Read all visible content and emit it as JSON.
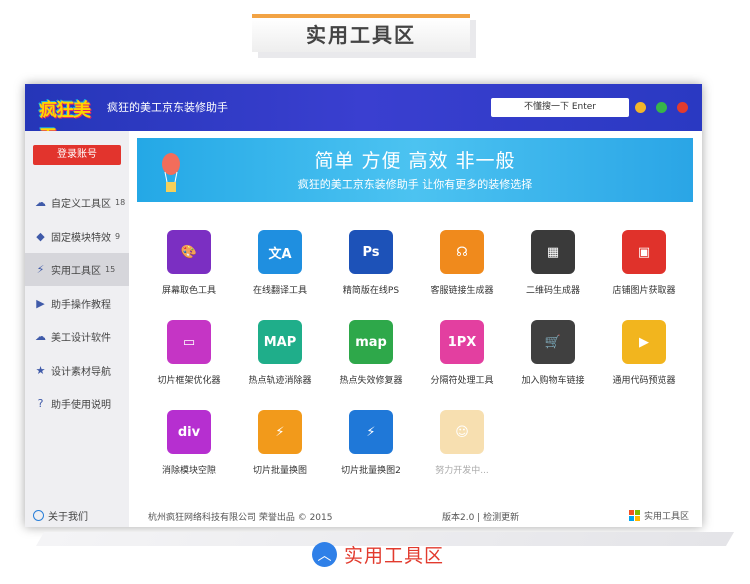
{
  "header_tab": "实用工具区",
  "window": {
    "logo_text": "疯狂美工",
    "app_title": "疯狂的美工京东装修助手",
    "search_placeholder": "不懂搜一下 Enter",
    "controls": [
      "#f3b52a",
      "#37b54a",
      "#e23b2e"
    ]
  },
  "sidebar": {
    "login": "登录账号",
    "items": [
      {
        "icon": "cloud-icon",
        "label": "自定义工具区",
        "count": "18"
      },
      {
        "icon": "cube-icon",
        "label": "固定模块特效",
        "count": "9"
      },
      {
        "icon": "bolt-icon",
        "label": "实用工具区",
        "count": "15",
        "active": true
      },
      {
        "icon": "play-icon",
        "label": "助手操作教程",
        "count": ""
      },
      {
        "icon": "cloud-download-icon",
        "label": "美工设计软件",
        "count": ""
      },
      {
        "icon": "star-icon",
        "label": "设计素材导航",
        "count": ""
      },
      {
        "icon": "help-icon",
        "label": "助手使用说明",
        "count": ""
      }
    ],
    "about": "关于我们"
  },
  "banner": {
    "title": "简单 方便 高效 非一般",
    "subtitle": "疯狂的美工京东装修助手 让你有更多的装修选择"
  },
  "tools": [
    {
      "name": "palette-icon",
      "label": "屏幕取色工具",
      "glyph": "🎨",
      "color": "#7b2fc2"
    },
    {
      "name": "translate-icon",
      "label": "在线翻译工具",
      "glyph": "文A",
      "color": "#1f8fe0"
    },
    {
      "name": "photoshop-icon",
      "label": "精简版在线PS",
      "glyph": "Ps",
      "color": "#1d52b8"
    },
    {
      "name": "headset-icon",
      "label": "客服链接生成器",
      "glyph": "☊",
      "color": "#f08a1c"
    },
    {
      "name": "qrcode-icon",
      "label": "二维码生成器",
      "glyph": "▦",
      "color": "#3a3a3a"
    },
    {
      "name": "image-download-icon",
      "label": "店铺图片获取器",
      "glyph": "▣",
      "color": "#e0322b"
    },
    {
      "name": "slice-icon",
      "label": "切片框架优化器",
      "glyph": "▭",
      "color": "#c535c5"
    },
    {
      "name": "map-icon",
      "label": "热点轨迹消除器",
      "glyph": "MAP",
      "color": "#1fae8a"
    },
    {
      "name": "map-repair-icon",
      "label": "热点失效修复器",
      "glyph": "map",
      "color": "#2ea84a"
    },
    {
      "name": "pixel-icon",
      "label": "分隔符处理工具",
      "glyph": "1PX",
      "color": "#e33fa0"
    },
    {
      "name": "cart-icon",
      "label": "加入购物车链接",
      "glyph": "🛒",
      "color": "#404040"
    },
    {
      "name": "code-viewer-icon",
      "label": "通用代码预览器",
      "glyph": "▶",
      "color": "#f2b51e"
    },
    {
      "name": "div-icon",
      "label": "消除模块空隙",
      "glyph": "div",
      "color": "#b62fd0"
    },
    {
      "name": "batch-image-icon",
      "label": "切片批量换图",
      "glyph": "⚡",
      "color": "#f29a1b"
    },
    {
      "name": "batch-image2-icon",
      "label": "切片批量换图2",
      "glyph": "⚡",
      "color": "#1f78d8"
    },
    {
      "name": "smiley-icon",
      "label": "努力开发中...",
      "glyph": "☺",
      "color": "#f7dfb0",
      "disabled": true
    }
  ],
  "footer": {
    "copyright": "杭州疯狂网络科技有限公司  荣誉出品  ©  2015",
    "version": "版本2.0  |  检测更新",
    "right": "实用工具区"
  },
  "bottom_label": "实用工具区"
}
